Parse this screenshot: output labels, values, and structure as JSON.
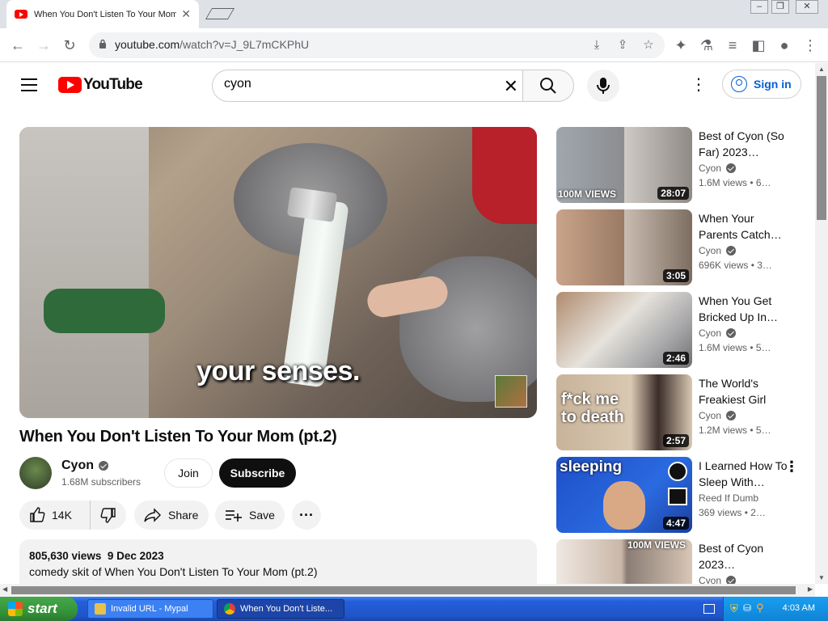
{
  "browser": {
    "tab_title": "When You Don't Listen To Your Mom",
    "url_host": "youtube.com",
    "url_path": "/watch?v=J_9L7mCKPhU"
  },
  "yt": {
    "logo_word": "YouTube",
    "search_value": "cyon",
    "signin_label": "Sign in"
  },
  "video": {
    "caption": "your senses.",
    "title": "When You Don't Listen To Your Mom (pt.2)",
    "channel": "Cyon",
    "subscribers": "1.68M subscribers",
    "join_label": "Join",
    "subscribe_label": "Subscribe",
    "likes": "14K",
    "share_label": "Share",
    "save_label": "Save",
    "views": "805,630 views",
    "date": "9 Dec 2023",
    "description": "comedy skit of When You Don't Listen To Your Mom (pt.2)"
  },
  "recommendations": [
    {
      "title": "Best of Cyon (So Far) 2023…",
      "channel": "Cyon",
      "views": "1.6M views",
      "age": "• 6…",
      "duration": "28:07",
      "overlay": "100M VIEWS"
    },
    {
      "title": "When Your Parents Catch…",
      "channel": "Cyon",
      "views": "696K views",
      "age": "• 3…",
      "duration": "3:05",
      "overlay": ""
    },
    {
      "title": "When You Get Bricked Up In…",
      "channel": "Cyon",
      "views": "1.6M views",
      "age": "• 5…",
      "duration": "2:46",
      "overlay": ""
    },
    {
      "title": "The World's Freakiest Girl",
      "channel": "Cyon",
      "views": "1.2M views",
      "age": "• 5…",
      "duration": "2:57",
      "overlay": "f*ck me to death"
    },
    {
      "title": "I Learned How To Sleep With…",
      "channel": "Reed If Dumb",
      "views": "369 views",
      "age": "• 2…",
      "duration": "4:47",
      "overlay": "sleeping"
    },
    {
      "title": "Best of Cyon 2023…",
      "channel": "Cyon",
      "views": "",
      "age": "",
      "duration": "",
      "overlay": "100M VIEWS"
    }
  ],
  "taskbar": {
    "start_label": "start",
    "task1": "Invalid URL - Mypal",
    "task2": "When You Don't Liste...",
    "clock": "4:03 AM"
  }
}
